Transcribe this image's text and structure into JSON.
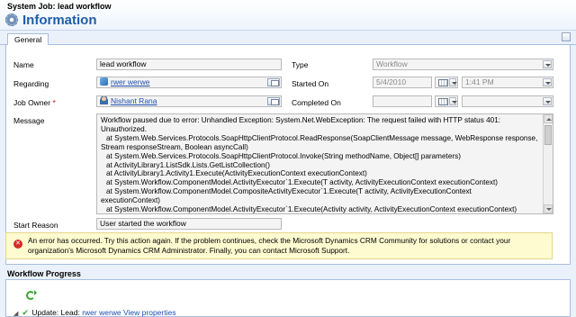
{
  "header": {
    "subtitle": "System Job: lead workflow",
    "title": "Information"
  },
  "tabs": [
    {
      "label": "General"
    }
  ],
  "form": {
    "name": {
      "label": "Name",
      "value": "lead workflow"
    },
    "type": {
      "label": "Type",
      "value": "Workflow"
    },
    "regarding": {
      "label": "Regarding",
      "value": "rwer werwe"
    },
    "started_on": {
      "label": "Started On",
      "date": "5/4/2010",
      "time": "1:41 PM"
    },
    "job_owner": {
      "label": "Job Owner",
      "required_marker": "*",
      "value": "Nishant Rana"
    },
    "completed_on": {
      "label": "Completed On"
    },
    "message": {
      "label": "Message",
      "lines": [
        "Workflow paused due to error: Unhandled Exception: System.Net.WebException: The request failed with HTTP status 401:",
        "Unauthorized.",
        "at System.Web.Services.Protocols.SoapHttpClientProtocol.ReadResponse(SoapClientMessage message, WebResponse response,",
        "Stream responseStream, Boolean asyncCall)",
        "at System.Web.Services.Protocols.SoapHttpClientProtocol.Invoke(String methodName, Object[] parameters)",
        "at ActivityLibrary1.ListSdk.Lists.GetListCollection()",
        "at ActivityLibrary1.Activity1.Execute(ActivityExecutionContext executionContext)",
        "at System.Workflow.ComponentModel.ActivityExecutor`1.Execute(T activity, ActivityExecutionContext executionContext)",
        "at System.Workflow.ComponentModel.CompositeActivityExecutor`1.Execute(T activity, ActivityExecutionContext",
        "executionContext)",
        "at System.Workflow.ComponentModel.ActivityExecutor`1.Execute(Activity activity, ActivityExecutionContext executionContext)"
      ]
    },
    "start_reason": {
      "label": "Start Reason",
      "value": "User started the workflow"
    }
  },
  "error": {
    "text": "An error has occurred. Try this action again. If the problem continues, check the Microsoft Dynamics CRM Community for solutions or contact your organization's Microsoft Dynamics CRM Administrator. Finally, you can contact Microsoft Support."
  },
  "progress": {
    "title": "Workflow Progress",
    "step": {
      "label": "Update:",
      "entity": "Lead:",
      "record": "rwer werwe",
      "link": "View properties"
    }
  },
  "colors": {
    "title_blue": "#1f5ea8",
    "link_blue": "#1f4fae",
    "error_bg": "#fffbd0",
    "error_red": "#d72b2b",
    "success_green": "#3aa532"
  },
  "icons": [
    "gear-icon",
    "lead-icon",
    "user-icon",
    "lookup-icon",
    "calendar-icon",
    "error-icon",
    "refresh-icon",
    "check-icon"
  ]
}
